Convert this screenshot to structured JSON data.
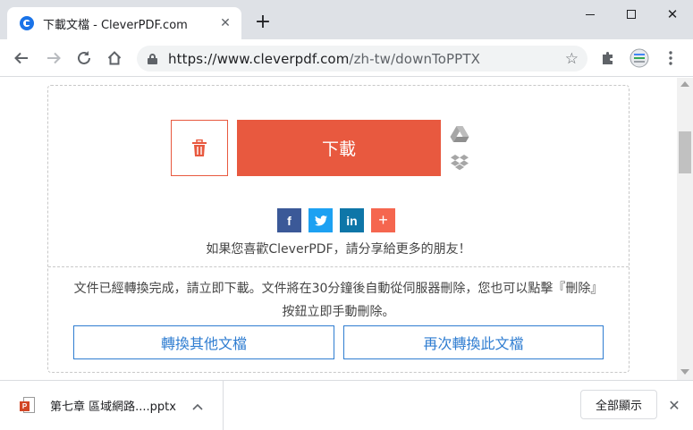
{
  "browser": {
    "tab": {
      "title": "下載文檔 - CleverPDF.com",
      "close": "✕"
    },
    "new_tab": "+",
    "window": {
      "close": "✕"
    },
    "address": {
      "host": "https://www.cleverpdf.com",
      "path": "/zh-tw/downToPPTX"
    }
  },
  "page": {
    "download_label": "下載",
    "share": {
      "facebook": "f",
      "linkedin": "in",
      "more": "+"
    },
    "share_text": "如果您喜歡CleverPDF，請分享給更多的朋友！",
    "notice_line1": "文件已經轉換完成，請立即下載。文件將在30分鐘後自動從伺服器刪除，您也可以點擊『刪除』",
    "notice_line2": "按鈕立即手動刪除。",
    "convert_other_label": "轉換其他文檔",
    "convert_again_label": "再次轉換此文檔",
    "accent_color": "#e8593f",
    "link_color": "#2f7dd1"
  },
  "downloads": {
    "file": {
      "name": "第七章 區域網路....pptx",
      "badge": "P"
    },
    "show_all_label": "全部顯示",
    "close": "✕"
  }
}
